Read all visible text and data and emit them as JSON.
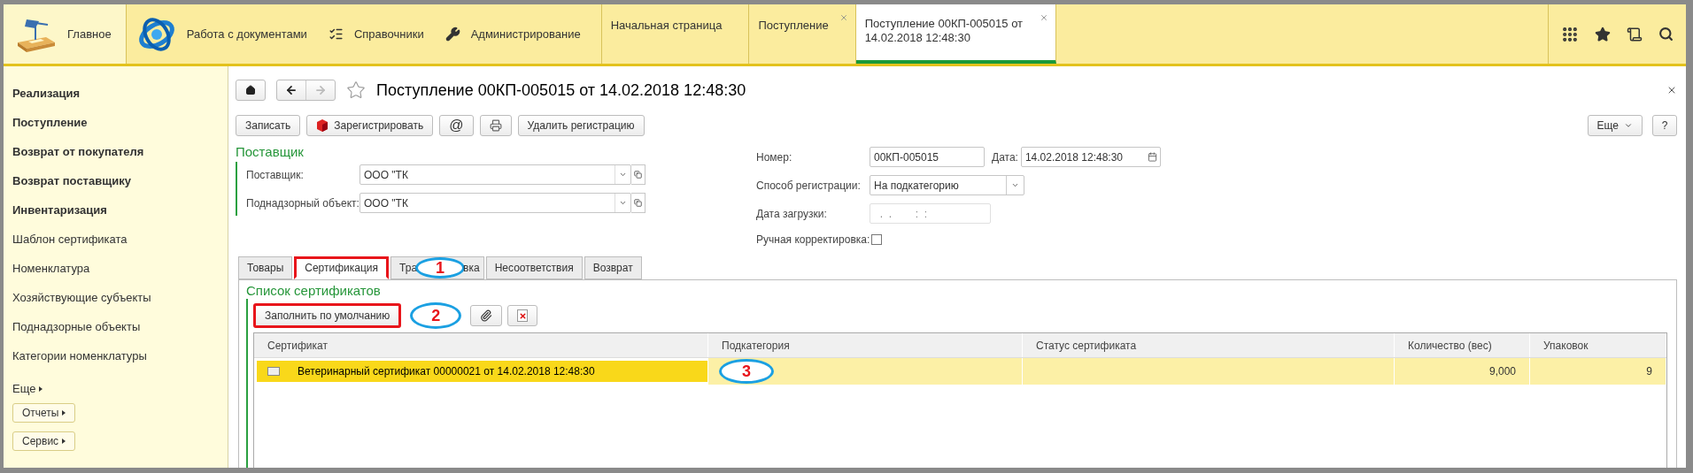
{
  "top_sections": [
    {
      "label": "Главное",
      "selected": true
    },
    {
      "label": "Работа с документами",
      "selected": false
    },
    {
      "label": "Справочники",
      "selected": false
    },
    {
      "label": "Администрирование",
      "selected": false
    }
  ],
  "open_tabs": [
    {
      "label": "Начальная страница",
      "selected": false,
      "closable": false
    },
    {
      "label": "Поступление",
      "selected": false,
      "closable": true
    },
    {
      "label": "Поступление 00КП-005015 от 14.02.2018 12:48:30",
      "selected": true,
      "closable": true
    }
  ],
  "sidebar": {
    "items": [
      {
        "label": "Реализация",
        "bold": true
      },
      {
        "label": "Поступление",
        "bold": true
      },
      {
        "label": "Возврат от покупателя",
        "bold": true
      },
      {
        "label": "Возврат поставщику",
        "bold": true
      },
      {
        "label": "Инвентаризация",
        "bold": true
      },
      {
        "label": "Шаблон сертификата",
        "bold": false
      },
      {
        "label": "Номенклатура",
        "bold": false
      },
      {
        "label": "Хозяйствующие субъекты",
        "bold": false
      },
      {
        "label": "Поднадзорные объекты",
        "bold": false
      },
      {
        "label": "Категории номенклатуры",
        "bold": false
      }
    ],
    "more": "Еще",
    "buttons": [
      "Отчеты",
      "Сервис"
    ]
  },
  "form": {
    "title": "Поступление 00КП-005015 от 14.02.2018 12:48:30",
    "favorite": false,
    "toolbar": [
      {
        "kind": "text",
        "label": "Записать"
      },
      {
        "kind": "register",
        "label": "Зарегистрировать"
      },
      {
        "kind": "char",
        "label": "@"
      },
      {
        "kind": "print"
      },
      {
        "kind": "text",
        "label": "Удалить регистрацию"
      }
    ],
    "more": "Еще",
    "help": "?",
    "supplier_group": {
      "title": "Поставщик",
      "fields": [
        {
          "label": "Поставщик:",
          "value": "ООО \"ТК"
        },
        {
          "label": "Поднадзорный объект:",
          "value": "ООО \"ТК"
        }
      ]
    },
    "number": {
      "label": "Номер:",
      "value": "00КП-005015"
    },
    "date": {
      "label": "Дата:",
      "value": "14.02.2018 12:48:30"
    },
    "registration_method": {
      "label": "Способ регистрации:",
      "value": "На подкатегорию"
    },
    "load_date": {
      "label": "Дата загрузки:",
      "placeholder": "  .  .        :  :"
    },
    "manual_correction": {
      "label": "Ручная корректировка:",
      "checked": false
    },
    "tabs": [
      {
        "label": "Товары",
        "selected": false,
        "highlighted": false
      },
      {
        "label": "Сертификация",
        "selected": true,
        "highlighted": true
      },
      {
        "label": "Тра",
        "callout": "1",
        "label_end": "вка",
        "selected": false,
        "highlighted": false
      },
      {
        "label": "Несоответствия",
        "selected": false,
        "highlighted": false
      },
      {
        "label": "Возврат",
        "selected": false,
        "highlighted": false
      }
    ],
    "certificates": {
      "title": "Список сертификатов",
      "buttons": [
        {
          "kind": "text",
          "label": "Заполнить по умолчанию",
          "highlighted": true
        },
        {
          "kind": "callout",
          "label": "2"
        },
        {
          "kind": "attach",
          "highlighted": false
        },
        {
          "kind": "delete",
          "highlighted": false
        }
      ],
      "table": {
        "columns": [
          "Сертификат",
          "Подкатегория",
          "Статус сертификата",
          "Количество (вес)",
          "Упаковок"
        ],
        "rows": [
          {
            "selected": true,
            "highlighted": true,
            "callout": "3",
            "cells": [
              "Ветеринарный сертификат 00000021 от 14.02.2018 12:48:30",
              "",
              "",
              "9,000",
              "9"
            ]
          }
        ]
      }
    }
  }
}
